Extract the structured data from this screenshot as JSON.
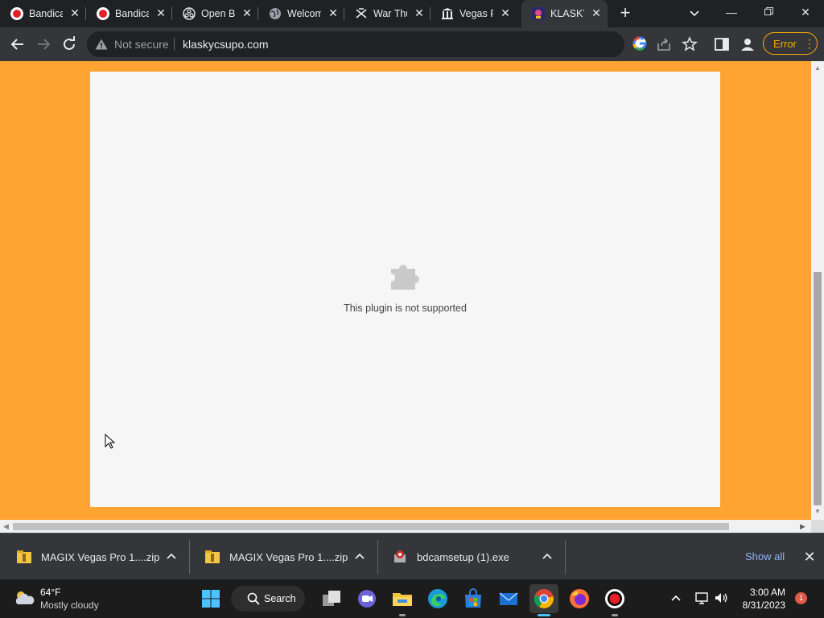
{
  "browser": {
    "tabs": [
      {
        "title": "Bandicam",
        "favicon": "bandicam-icon",
        "active": false
      },
      {
        "title": "Bandicam",
        "favicon": "bandicam-icon",
        "active": false
      },
      {
        "title": "Open Broadcaster",
        "favicon": "obs-icon",
        "active": false
      },
      {
        "title": "Welcome",
        "favicon": "globe-icon",
        "active": false
      },
      {
        "title": "War Thunder",
        "favicon": "war-thunder-icon",
        "active": false
      },
      {
        "title": "Vegas Pro",
        "favicon": "vegas-icon",
        "active": false
      },
      {
        "title": "KLASKY",
        "favicon": "klasky-icon",
        "active": true
      }
    ],
    "address": {
      "security_label": "Not secure",
      "url": "klaskycsupo.com"
    },
    "error_button_label": "Error"
  },
  "page": {
    "background_color": "#ffa433",
    "plugin_message": "This plugin is not supported"
  },
  "downloads": {
    "items": [
      {
        "name": "MAGIX Vegas Pro 1....zip",
        "icon": "zip-archive-icon"
      },
      {
        "name": "MAGIX Vegas Pro 1....zip",
        "icon": "zip-archive-icon"
      },
      {
        "name": "bdcamsetup (1).exe",
        "icon": "installer-icon"
      }
    ],
    "show_all_label": "Show all"
  },
  "taskbar": {
    "weather": {
      "temperature": "64°F",
      "condition": "Mostly cloudy"
    },
    "search_label": "Search",
    "clock": {
      "time": "3:00 AM",
      "date": "8/31/2023"
    },
    "notification_count": "1"
  }
}
